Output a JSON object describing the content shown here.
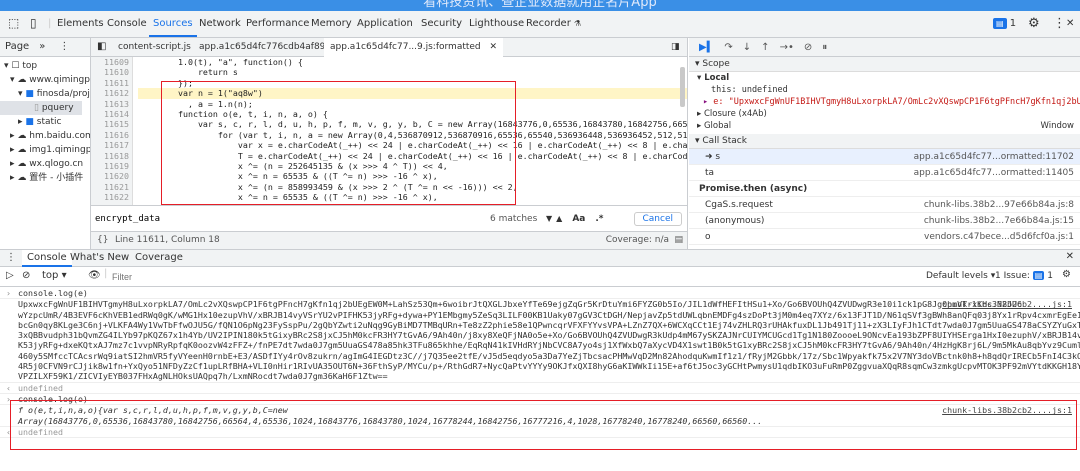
{
  "banner_text": "看科技资讯、查企业数据就用企名片App",
  "toolbar": {
    "tabs": [
      "Elements",
      "Console",
      "Sources",
      "Network",
      "Performance",
      "Memory",
      "Application",
      "Security",
      "Lighthouse",
      "Recorder"
    ],
    "active_tab": "Sources",
    "issues_count": "1"
  },
  "navigator": {
    "header": "Page",
    "tree": [
      "top",
      "www.qimingpia",
      "finosda/proje",
      "pquery",
      "static",
      "hm.baidu.com",
      "img1.qimingpia",
      "wx.qlogo.cn",
      "置件 - 小插件"
    ]
  },
  "editor": {
    "tabs": [
      "content-script.js",
      "app.a1c65d4fc776cdb4af89.js",
      "app.a1c65d4fc77...9.js:formatted"
    ],
    "line_numbers": [
      "11609",
      "11610",
      "11611",
      "11612",
      "11613",
      "11614",
      "11615",
      "11616",
      "11617",
      "11618",
      "11619",
      "11620",
      "11621",
      "11622"
    ],
    "code_lines": [
      "        1.0(t), \"a\", function() {",
      "            return s",
      "        });",
      "        var n = 1(\"aq8w\")",
      "          , a = 1.n(n);",
      "        function o(e, t, i, n, a, o) {",
      "            var s, c, r, l, d, u, h, p, f, m, v, g, y, b, C = new Array(16843776,0,65536,16843780,16842756,66564,4,6553",
      "                for (var t, i, n, a = new Array(0,4,536870912,536870916,65536,65540,536936448,536936452,512,516,5368714",
      "                    var x = e.charCodeAt(_++) << 24 | e.charCodeAt(_++) << 16 | e.charCodeAt(_++) << 8 | e.charCodeAt(_++",
      "                    T = e.charCodeAt(_++) << 24 | e.charCodeAt(_++) << 16 | e.charCodeAt(_++) << 8 | e.charCodeAt(_++",
      "                    x ^= (n = 252645135 & (x >>> 4 ^ T)) << 4,",
      "                    x ^= n = 65535 & ((T ^= n) >>> -16 ^ x),",
      "                    x ^= (n = 858993459 & (x >>> 2 ^ (T ^= n << -16))) << 2,",
      "                    x ^= n = 65535 & ((T ^= n) >>> -16 ^ x),"
    ],
    "find_query": "encrypt_data",
    "find_matches": "6 matches",
    "find_case": "Aa",
    "find_regex": ".*",
    "find_cancel": "Cancel",
    "status_position": "Line 11611, Column 18",
    "status_coverage": "Coverage: n/a"
  },
  "debugger": {
    "scope_title": "Scope",
    "local_title": "Local",
    "this_line": "this: undefined",
    "e_line": "e: \"UpxwxcFgWnUF1BIHVTgmyH8uLxorpkLA7/OmLc2vXQswpCP1F6tgPFncH7gKfn1qj2bUEgEW0M+",
    "closure": "Closure (x4Ab)",
    "global": "Global",
    "global_val": "Window",
    "callstack_title": "Call Stack",
    "frames": [
      {
        "fn": "s",
        "loc": "app.a1c65d4fc77...ormatted:11702"
      },
      {
        "fn": "ta",
        "loc": "app.a1c65d4fc77...ormatted:11405"
      },
      {
        "fn": "Promise.then (async)",
        "loc": ""
      },
      {
        "fn": "CgaS.s.request",
        "loc": "chunk-libs.38b2...97e66b84a.js:8"
      },
      {
        "fn": "(anonymous)",
        "loc": "chunk-libs.38b2...7e66b84a.js:15"
      },
      {
        "fn": "o",
        "loc": "vendors.c47bece...d5d6fcf0a.js:1"
      }
    ]
  },
  "drawer": {
    "tabs": [
      "Console",
      "What's New",
      "Coverage"
    ],
    "context": "top",
    "filter_placeholder": "Filter",
    "levels": "Default levels",
    "issue_label": "1 Issue:",
    "issue_count": "1",
    "logs": [
      {
        "kind": "input",
        "text": "console.log(e)"
      },
      {
        "kind": "output",
        "text": "UpxwxcFgWnUF1BIHVTgmyH8uLxorpkLA7/OmLc2vXQswpCP1F6tgPFncH7gKfn1qj2bUEgEW0M+LahSz53Qm+6woibrJtQXGLJbxeYfTe69ejgZqGr5KrDtuYmi6FYZG0b5Io/JIL1dWfHEFItHSu1+Xo/Go6BVOUhQ4ZVUDwgR3e10i1ck1pG8Jg0pmVTrxKHc3N2JU6\nwYzpcUmR/4B3EVF6cKhVEB1edRWq0gK/wMG1Hx10ezupVhV/xBRJB14vyVSrYU2vPIFHK53jyRFg+dywa+PY1EMbgmy5ZeSq3LILF00KB1Uaky07gGV3CtDGH/NepjavZp5tdUWLqbnEMDFg4szDoPt3jM0m4eq7XYz/6x13FJT1D/N61qSVf3gBWh8anQFq03j8Yx1rRpv4cxmrEgEe1aGq1vv0+3BgEh\nbcGn0qy8KLge3C6nj+VLKFA4Wy1VwTbFfwOJU5G/fQN1O6pNg23FySspPu/2gQbYZwti2uNqg9GyBiMD7TMBqURn+Te8zZ2phie58e1QPwncqrVFXFYYvsVPA+LZnZ7QX+6WCXqCCt1Ej74vZHLRQ3rUHAkfuxDL1Jb491Tj11+zX3LIyFJh1CTdt7wda0J7gm5UuaGS478aCSYZYuGxTxT3damH8+uYB\n3xQBBvudph31bQvmZG4ILYb97pKQZ67x1h4Yb/UV2IPIN180k5tGixyBRc2S8jxCJ5hM0kcFR3HY7tGvA6/9Ah40n/j8xy8XeQFjNA0o5e+Xo/Go6BVOUhQ4ZVUDwgR3kUdp4mM67ySKZAJNrCUIYMCUGcd1Tg1N180ZoooeL9ONcvEa193bZPF8UIYHSErga1HxI0ezuphV/xBRJB14vyVSrYU2vPIFH\nK53jyRFg+dxeKQtxAJ7mz7c1vvpNRyRpfqK0oozvW4zFFZ+/fnPE7dt7wda0J7gm5UuaGS478a85hk3TFu865khhe/EqRqN41kIVHdRYjNbCVC8A7yo4sj1XfWxbQ7aXycVD4X1swt1B0k5tG1xyBRc2S8jxCJ5hM0kcFR3HY7tGvA6/9Ah40n/4HzHgK8rj6L/9m5MkAu8qbYvz9Cumlx7t/bInRp2NuT\n460y5SMfccTCAcsrWq9iatSI2hmVR5fyVYeenH0rnbE+E3/ASDfIYy4rOv8zukrn/agImG4IEGDtz3C//j7Q35ee2tfE/vJ5d5eqdyo5a3Da7YeZjTbcsacPHMwVqD2Mn82AhodquKwmIf1z1/fRyjM2Gbbk/17z/Sbc1Wpyakfk75x2V7NY3doVBctnk0h8+h8qdQrIRECb5FnI4C3kOhR\n4R5j0CFVN9rCJjik8w1fn+YxQyo51NFDyZzCf1upLRfBHA+VLI0nHir1RIvUA35OUT6N+36FthSyP/MYCu/p+/RthGdR7+NycQaPtvYYYy9OKJfxQXI8hyG6aKIWWkIi15E+af6tJ5oc3yGCHtPwmysU1qdbIKO3uFuRmP0ZggvuaXQqR8sqmCw3zmkgUcpvMTOK3PF92mVYtdKKGH18YtMo+yY9GW\nVPZILXF59K1/ZICVIyEYB037FHxAgNLHOksUAQpq7h/LxmNRocdt7wda0J7gm36KaH6F1Ztw==",
        "src": "chunk-libs.38b2cb2....js:1"
      },
      {
        "kind": "undef",
        "text": "undefined"
      },
      {
        "kind": "input",
        "text": "console.log(o)"
      },
      {
        "kind": "output",
        "text": "f o(e,t,i,n,a,o){var s,c,r,l,d,u,h,p,f,m,v,g,y,b,C=new\nArray(16843776,0,65536,16843780,16842756,66564,4,65536,1024,16843776,16843780,1024,16778244,16842756,16777216,4,1028,16778240,16778240,66560,66560...",
        "src": "chunk-libs.38b2cb2....js:1"
      },
      {
        "kind": "undef",
        "text": "undefined"
      }
    ]
  }
}
